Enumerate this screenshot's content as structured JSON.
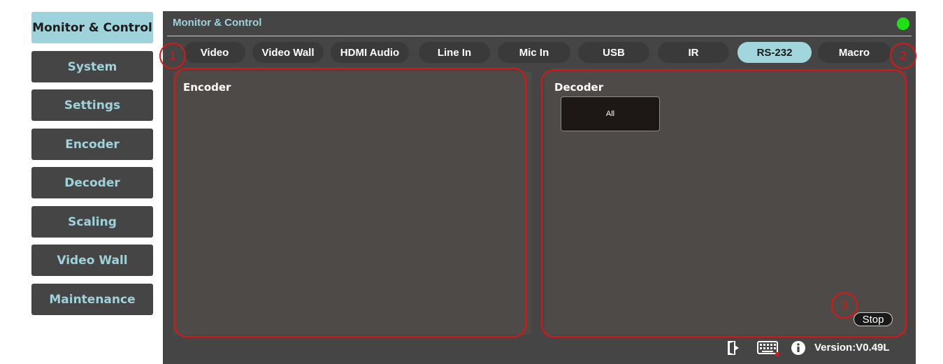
{
  "sidebar": {
    "items": [
      {
        "label": "Monitor & Control",
        "active": true
      },
      {
        "label": "System"
      },
      {
        "label": "Settings"
      },
      {
        "label": "Encoder"
      },
      {
        "label": "Decoder"
      },
      {
        "label": "Scaling"
      },
      {
        "label": "Video Wall"
      },
      {
        "label": "Maintenance"
      }
    ]
  },
  "header": {
    "title": "Monitor & Control",
    "status_color": "#1ee012"
  },
  "tabs": [
    {
      "label": "Video"
    },
    {
      "label": "Video Wall"
    },
    {
      "label": "HDMI Audio"
    },
    {
      "label": "Line In"
    },
    {
      "label": "Mic In"
    },
    {
      "label": "USB"
    },
    {
      "label": "IR"
    },
    {
      "label": "RS-232",
      "active": true
    },
    {
      "label": "Macro"
    }
  ],
  "encoder": {
    "title": "Encoder"
  },
  "decoder": {
    "title": "Decoder",
    "all_label": "All",
    "stop_label": "Stop"
  },
  "annotations": [
    "1",
    "2",
    "3"
  ],
  "footer": {
    "version": "Version:V0.49L",
    "icons": [
      "logout-icon",
      "keyboard-icon",
      "info-icon"
    ]
  },
  "colors": {
    "accent": "#9fd3db",
    "annotation": "#e01414",
    "panel_bg": "#454545"
  }
}
